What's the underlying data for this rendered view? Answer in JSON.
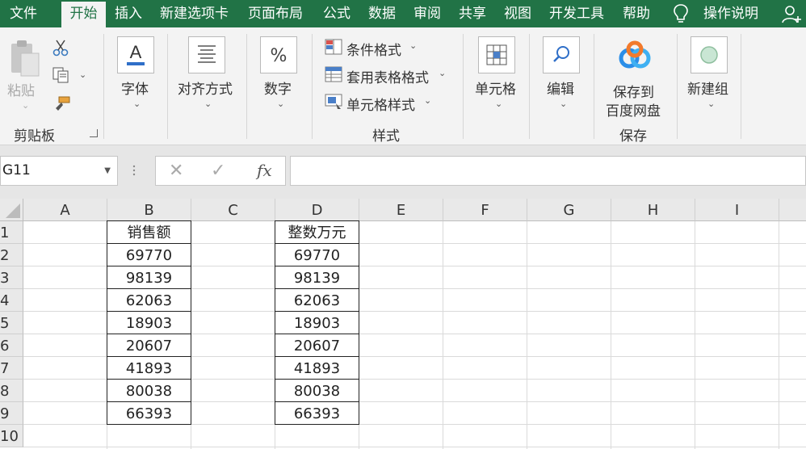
{
  "menu": {
    "tabs": [
      "文件",
      "开始",
      "插入",
      "新建选项卡",
      "页面布局",
      "公式",
      "数据",
      "审阅",
      "共享",
      "视图",
      "开发工具",
      "帮助"
    ],
    "active_tab": "开始",
    "tell_me": "操作说明",
    "icons": {
      "tell_me": "lightbulb-icon",
      "account": "person-add-icon"
    }
  },
  "ribbon": {
    "clipboard": {
      "paste": "粘贴",
      "group": "剪贴板"
    },
    "font": {
      "label": "字体"
    },
    "align": {
      "label": "对齐方式"
    },
    "number": {
      "label": "数字"
    },
    "styles": {
      "conditional": "条件格式",
      "table": "套用表格格式",
      "cell_styles": "单元格样式",
      "group": "样式"
    },
    "cells": {
      "label": "单元格"
    },
    "editing": {
      "label": "编辑"
    },
    "save": {
      "line1": "保存到",
      "line2": "百度网盘",
      "group": "保存"
    },
    "newgroup": {
      "label": "新建组"
    }
  },
  "formula_bar": {
    "name_box": "G11",
    "fx": "fx",
    "formula": ""
  },
  "sheet": {
    "columns": [
      "A",
      "B",
      "C",
      "D",
      "E",
      "F",
      "G",
      "H",
      "I"
    ],
    "rows": [
      "1",
      "2",
      "3",
      "4",
      "5",
      "6",
      "7",
      "8",
      "9",
      "10"
    ],
    "col_b": [
      "销售额",
      "69770",
      "98139",
      "62063",
      "18903",
      "20607",
      "41893",
      "80038",
      "66393"
    ],
    "col_d": [
      "整数万元",
      "69770",
      "98139",
      "62063",
      "18903",
      "20607",
      "41893",
      "80038",
      "66393"
    ]
  },
  "colors": {
    "brand": "#217346",
    "ribbon_bg": "#f3f3f3"
  }
}
